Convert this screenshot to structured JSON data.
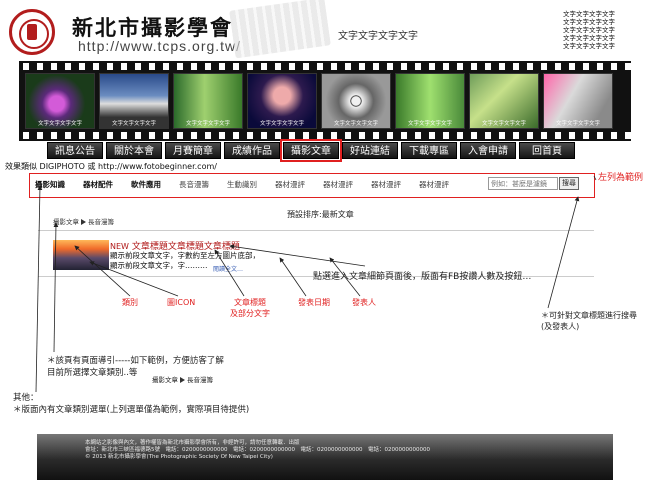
{
  "header": {
    "site_name": "新北市攝影學會",
    "url": "http://www.tcps.org.tw/",
    "center_text": "文字文字文字文字",
    "corner_lines": [
      "文字文字文字文字",
      "文字文字文字文字",
      "文字文字文字文字",
      "文字文字文字文字",
      "文字文字文字文字"
    ]
  },
  "banner": {
    "photo_caption": "文字文字文字文字"
  },
  "nav": [
    "訊息公告",
    "關於本會",
    "月賽簡章",
    "成績作品",
    "攝影文章",
    "好站連結",
    "下載專區",
    "入會申請",
    "回首頁"
  ],
  "nav_active": "攝影文章",
  "effect_note": "效果類似 DIGIPHOTO 或 http://www.fotobeginner.com/",
  "categories": [
    "攝影知識",
    "器材配件",
    "軟件應用",
    "長音漫籌",
    "生動識別",
    "器材漫評",
    "器材漫評",
    "器材漫評",
    "器材漫評"
  ],
  "search": {
    "placeholder": "例如：甚麼是濾鏡",
    "button": "搜尋"
  },
  "range_note": "左列為範例",
  "sort_label": "預設排序:最新文章",
  "breadcrumb": {
    "root": "攝影文章",
    "current": "長音漫籌"
  },
  "article": {
    "new_tag": "NEW",
    "title": "文章標題文章標題文章標題",
    "summary_lines": [
      "顯示前段文章文字，字數約至左方圖片底部，",
      "顯示前段文章文字，字………"
    ],
    "more": "閱讀全文…"
  },
  "click_note": "點選進入文章細節頁面後，版面有FB按讚人數及按鈕…",
  "labels": [
    "類別",
    "圖ICON",
    "文章標題\n及部分文字",
    "發表日期",
    "發表人"
  ],
  "side_note": [
    "＊可針對文章標題進行搜尋",
    "(及發表人)"
  ],
  "page_note": [
    "＊該頁有頁面導引-----如下範例，方便訪客了解",
    "目前所選擇文章類別..等"
  ],
  "other_note": [
    "其他：",
    "＊版面內有文章類別選單(上列選單僅為範例，實際項目待提供)"
  ],
  "footer": [
    "本網站之影像與內文，著作權皆為新北市攝影學會所有，非經許可，請勿任意轉載．出版",
    "會址：新北市三峽區福德路5號　電話：0200000000000　電話：0200000000000　電話：0200000000000　電話：0200000000000",
    "© 2013 新北市攝影學會(The Photographic Society Of New Taipei City)"
  ]
}
